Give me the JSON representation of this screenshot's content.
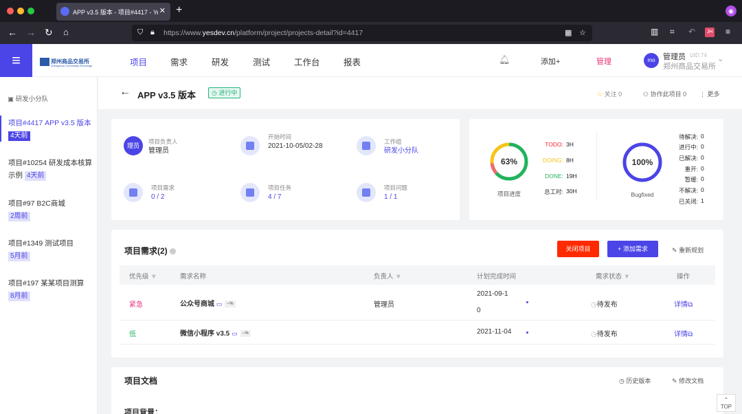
{
  "browser": {
    "tab_title": "APP v3.5 版本 - 项目#4417 - Yes",
    "url_prefix": "https://www.",
    "url_host": "yesdev.cn",
    "url_path": "/platform/project/projects-detail?id=4417",
    "ext_badge": "JH"
  },
  "header": {
    "logo_text": "郑州商品交易所",
    "logo_sub": "Zhengzhou Commodity Exchange",
    "nav": [
      "项目",
      "需求",
      "研发",
      "测试",
      "工作台",
      "报表"
    ],
    "add_label": "添加+",
    "admin_label": "管理",
    "user": {
      "avatar": "mo",
      "name": "管理员",
      "uid": "UID:74",
      "org": "郑州商品交易所"
    }
  },
  "sidebar": {
    "team": "研发小分队",
    "items": [
      {
        "text": "项目#4417 APP v3.5 版本",
        "ago": "4天前"
      },
      {
        "text": "项目#10254 研发成本核算示例",
        "ago": "4天前"
      },
      {
        "text": "项目#97 B2C商城",
        "ago": "2周前"
      },
      {
        "text": "项目#1349 测试项目",
        "ago": "5月前"
      },
      {
        "text": "项目#197 某某项目测算",
        "ago": "8月前"
      }
    ]
  },
  "project": {
    "title": "APP v3.5 版本",
    "status": "进行中",
    "follow": "关注 0",
    "collab": "协作此项目 0",
    "more": "更多"
  },
  "info": {
    "owner_icon": "理员",
    "owner_label": "项目负责人",
    "owner_value": "管理员",
    "start_label": "开始时间",
    "start_value": "2021-10-05/02-28",
    "group_label": "工作组",
    "group_value": "研发小分队",
    "req_label": "项目需求",
    "req_value": "0 / 2",
    "task_label": "项目任务",
    "task_value": "4 / 7",
    "issue_label": "项目问题",
    "issue_value": "1 / 1"
  },
  "progress": {
    "percent": 63,
    "percent_label": "63%",
    "caption": "项目进度",
    "stats": [
      {
        "label": "TODO:",
        "value": "3H",
        "color": "#f5222d"
      },
      {
        "label": "DOING:",
        "value": "8H",
        "color": "#f5c518"
      },
      {
        "label": "DONE:",
        "value": "19H",
        "color": "#21b35c"
      },
      {
        "label": "总工时:",
        "value": "30H",
        "color": "#333333"
      }
    ],
    "bug_percent": 100,
    "bug_label": "100%",
    "bug_caption": "Bugfixed",
    "bugs": [
      {
        "label": "待解决:",
        "value": "0"
      },
      {
        "label": "进行中:",
        "value": "0"
      },
      {
        "label": "已解决:",
        "value": "0"
      },
      {
        "label": "重开:",
        "value": "0"
      },
      {
        "label": "暂缓:",
        "value": "0"
      },
      {
        "label": "不解决:",
        "value": "0"
      },
      {
        "label": "已关闭:",
        "value": "1"
      }
    ]
  },
  "requirements": {
    "title": "项目需求(2)",
    "close_btn": "关闭项目",
    "add_btn": "+ 添加需求",
    "replan": "重新规划",
    "columns": [
      "优先级",
      "需求名称",
      "负责人",
      "计划完成时间",
      "需求状态",
      "操作"
    ],
    "rows": [
      {
        "priority": "紧急",
        "priority_color": "#e6337a",
        "name": "公众号商城",
        "tag": "--%",
        "owner": "管理员",
        "date_line1": "2021-09-1",
        "date_line2": "0",
        "status": "待发布",
        "action": "详情"
      },
      {
        "priority": "低",
        "priority_color": "#21b35c",
        "name": "微信小程序 v3.5",
        "tag": "--%",
        "owner": "",
        "date_line1": "2021-11-04",
        "date_line2": "",
        "status": "待发布",
        "action": "详情"
      }
    ]
  },
  "docs": {
    "title": "项目文档",
    "history": "历史版本",
    "edit": "修改文档",
    "background": "项目背景："
  },
  "top_btn": "TOP"
}
